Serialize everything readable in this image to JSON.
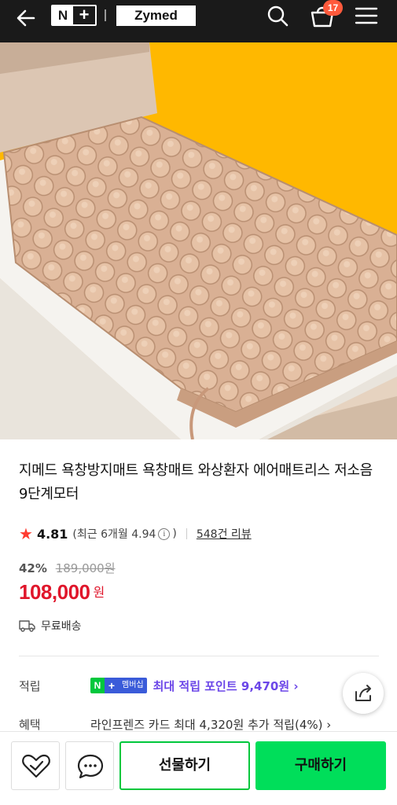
{
  "header": {
    "logo_n": "N",
    "logo_plus": "+",
    "brand": "Zymed",
    "cart_count": "17",
    "icons": [
      "back-arrow-icon",
      "search-icon",
      "cart-icon",
      "hamburger-menu-icon"
    ]
  },
  "product": {
    "title": "지메드 욕창방지매트 욕창매트 와상환자 에어매트리스 저소음 9단계모터",
    "image_icon": "air-mattress-product-photo",
    "image_bg_color": "#FFB800"
  },
  "rating": {
    "score": "4.81",
    "recent": "(최근 6개월 4.94",
    "recent_close": ")",
    "info": "i",
    "reviews": "548건 리뷰"
  },
  "price": {
    "discount": "42%",
    "original": "189,000원",
    "current": "108,000",
    "unit": "원",
    "accent_color": "#e0162b"
  },
  "shipping": {
    "label": "무료배송"
  },
  "points": {
    "label": "적립",
    "badge_n": "N",
    "badge_plus": "+",
    "badge_text": "멤버십",
    "text": "최대 적립 포인트 9,470원 ›",
    "color": "#6b46e8"
  },
  "benefit": {
    "label": "혜택",
    "text": "라인프렌즈 카드 최대 4,320원 추가 적립(4%) ›"
  },
  "bottom": {
    "gift": "선물하기",
    "buy": "구매하기",
    "buy_color": "#00de5a"
  }
}
